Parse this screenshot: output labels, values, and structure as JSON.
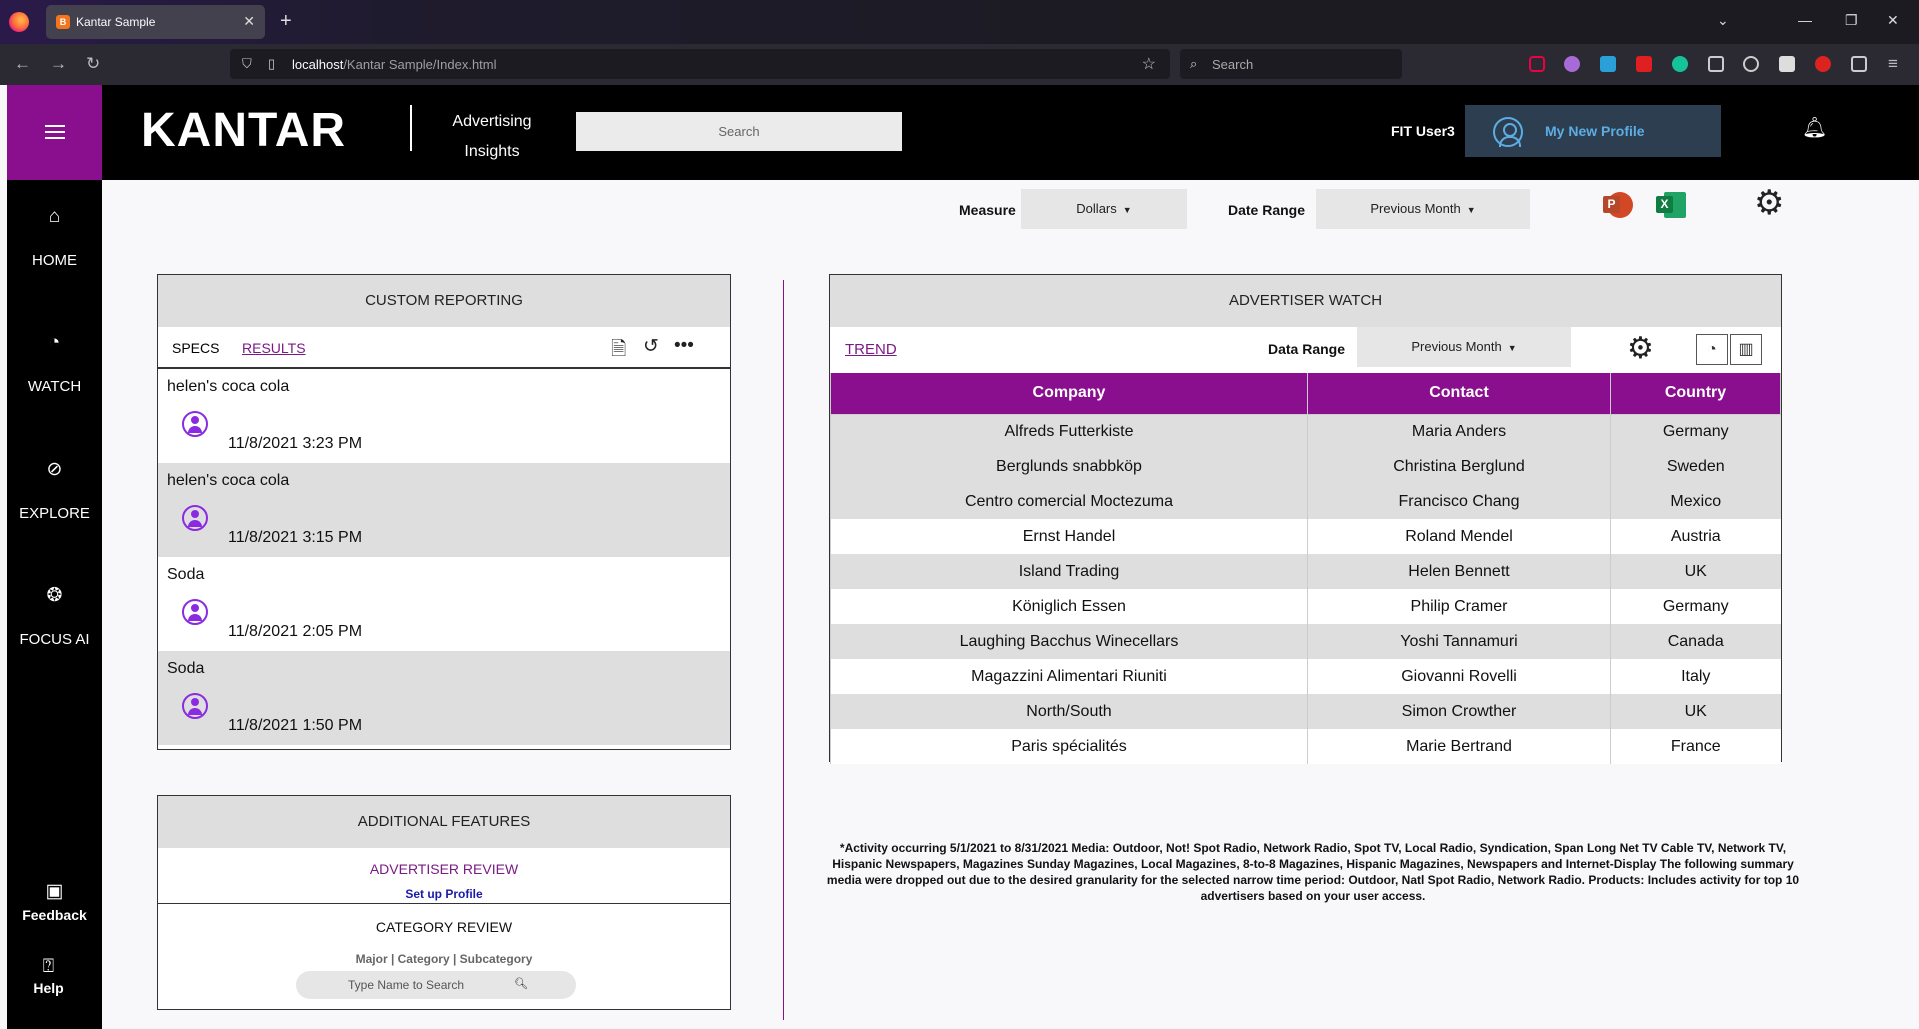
{
  "browser": {
    "tab_title": "Kantar Sample",
    "url_host": "localhost",
    "url_path": "/Kantar Sample/Index.html",
    "search_placeholder": "Search"
  },
  "header": {
    "logo": "KANTAR",
    "app_name_line1": "Advertising",
    "app_name_line2": "Insights",
    "search_placeholder": "Search",
    "user_name": "FIT User3",
    "profile_button": "My New Profile"
  },
  "sidebar": {
    "items": [
      {
        "label": "HOME",
        "icon": "home-icon"
      },
      {
        "label": "WATCH",
        "icon": "gauge-icon"
      },
      {
        "label": "EXPLORE",
        "icon": "compass-icon"
      },
      {
        "label": "FOCUS AI",
        "icon": "brain-icon"
      }
    ],
    "feedback": "Feedback",
    "help": "Help"
  },
  "controls": {
    "measure_label": "Measure",
    "measure_value": "Dollars",
    "date_range_label": "Date Range",
    "date_range_value": "Previous Month"
  },
  "custom_reporting": {
    "title": "CUSTOM REPORTING",
    "tabs": [
      "SPECS",
      "RESULTS"
    ],
    "items": [
      {
        "title": "helen's coca cola",
        "date": "11/8/2021 3:23 PM"
      },
      {
        "title": "helen's coca cola",
        "date": "11/8/2021 3:15 PM"
      },
      {
        "title": "Soda",
        "date": "11/8/2021 2:05 PM"
      },
      {
        "title": "Soda",
        "date": "11/8/2021 1:50 PM"
      }
    ]
  },
  "additional_features": {
    "title": "ADDITIONAL FEATURES",
    "advertiser_review": "ADVERTISER REVIEW",
    "setup_profile": "Set up Profile",
    "category_review": "CATEGORY REVIEW",
    "category_levels": "Major | Category | Subcategory",
    "search_placeholder": "Type Name to Search"
  },
  "advertiser_watch": {
    "title": "ADVERTISER WATCH",
    "trend": "TREND",
    "data_range_label": "Data Range",
    "data_range_value": "Previous Month",
    "columns": [
      "Company",
      "Contact",
      "Country"
    ],
    "rows": [
      [
        "Alfreds Futterkiste",
        "Maria Anders",
        "Germany"
      ],
      [
        "Berglunds snabbköp",
        "Christina Berglund",
        "Sweden"
      ],
      [
        "Centro comercial Moctezuma",
        "Francisco Chang",
        "Mexico"
      ],
      [
        "Ernst Handel",
        "Roland Mendel",
        "Austria"
      ],
      [
        "Island Trading",
        "Helen Bennett",
        "UK"
      ],
      [
        "Königlich Essen",
        "Philip Cramer",
        "Germany"
      ],
      [
        "Laughing Bacchus Winecellars",
        "Yoshi Tannamuri",
        "Canada"
      ],
      [
        "Magazzini Alimentari Riuniti",
        "Giovanni Rovelli",
        "Italy"
      ],
      [
        "North/South",
        "Simon Crowther",
        "UK"
      ],
      [
        "Paris spécialités",
        "Marie Bertrand",
        "France"
      ]
    ]
  },
  "footnote": "*Activity occurring 5/1/2021 to 8/31/2021 Media: Outdoor, Not! Spot Radio, Network Radio, Spot TV, Local Radio, Syndication, Span Long Net TV Cable TV, Network TV, Hispanic Newspapers, Magazines Sunday Magazines, Local Magazines, 8-to-8 Magazines, Hispanic Magazines, Newspapers and Internet-Display The following summary media were dropped out due to the desired granularity for the selected narrow time period: Outdoor, Natl Spot Radio, Network Radio. Products: Includes activity for top 10 advertisers based on your user access.",
  "colors": {
    "brand_purple": "#8a0f8e",
    "link_purple": "#7b1a84",
    "profile_blue": "#5dade2"
  }
}
